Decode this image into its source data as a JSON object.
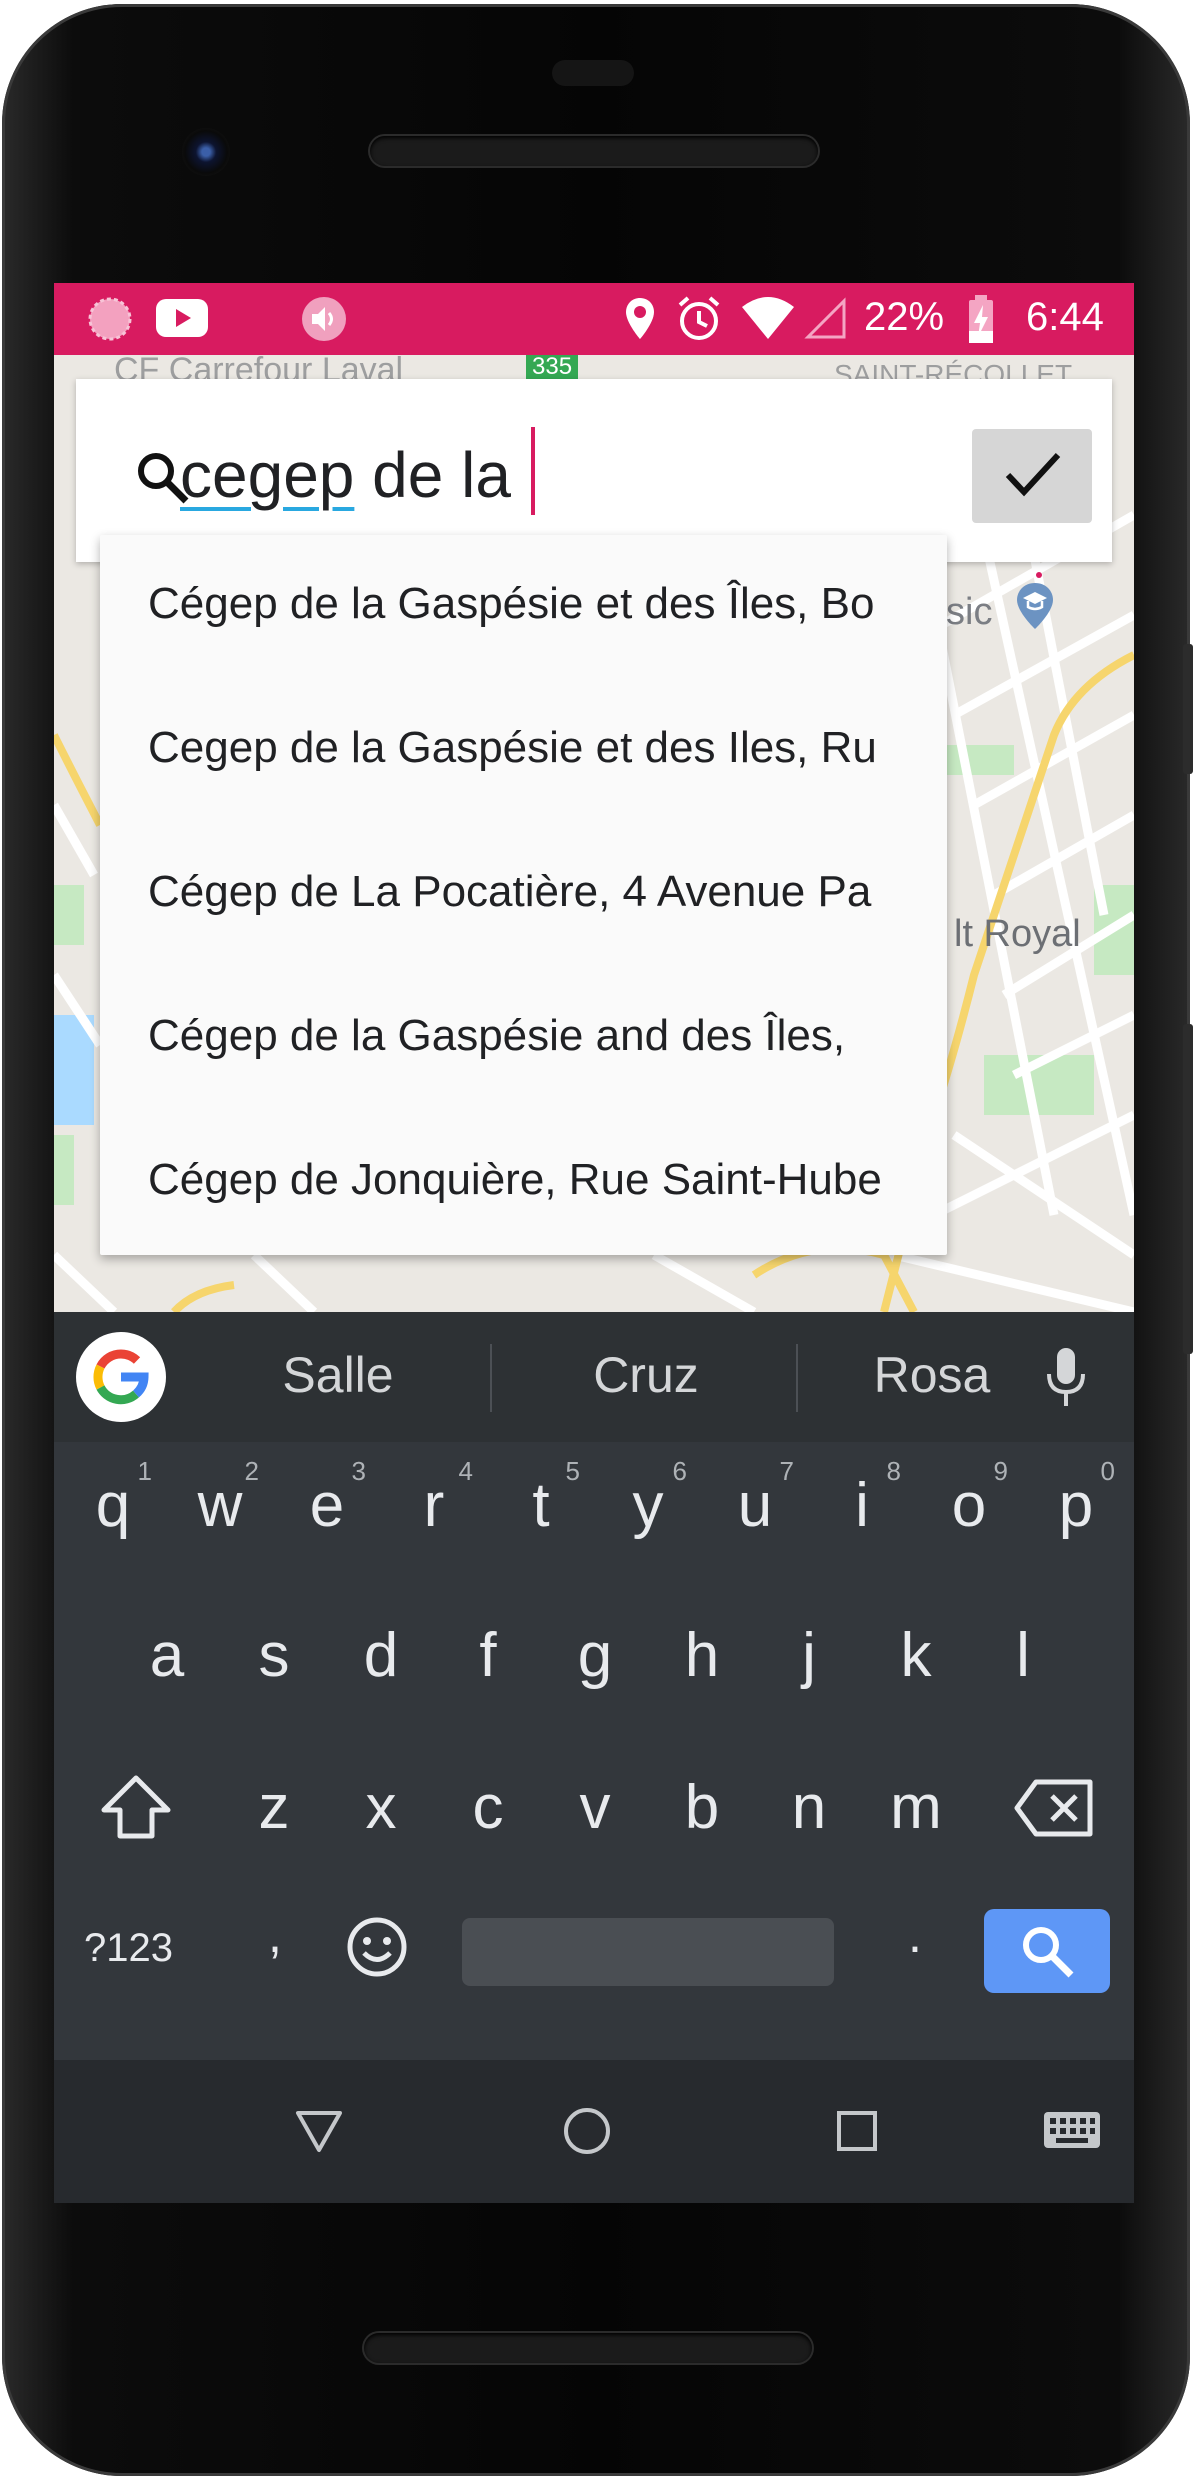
{
  "status_bar": {
    "battery": "22%",
    "time": "6:44",
    "icons": [
      "app-circle-icon",
      "youtube-icon",
      "volume-icon",
      "location-icon",
      "alarm-icon",
      "wifi-icon",
      "signal-icon",
      "battery-charging-icon"
    ],
    "background": "#d81b60"
  },
  "map": {
    "labels": {
      "top_left": "CF Carrefour Laval",
      "road_sign": "335",
      "top_right": "SAINT-RÉCOLLET",
      "middle_right": "sic",
      "lower_right": "lt Royal"
    }
  },
  "search": {
    "query_underlined": "cegep",
    "query_rest": " de la",
    "confirm_icon": "check-icon"
  },
  "suggestions": [
    "Cégep de la Gaspésie et des Îles, Bo",
    "Cegep de la Gaspésie et des Iles, Ru",
    "Cégep de La Pocatière, 4 Avenue Pa",
    "Cégep de la Gaspésie and des Îles,",
    "Cégep de Jonquière, Rue Saint-Hube"
  ],
  "keyboard": {
    "suggestions": [
      "Salle",
      "Cruz",
      "Rosa"
    ],
    "row1": [
      {
        "k": "q",
        "h": "1"
      },
      {
        "k": "w",
        "h": "2"
      },
      {
        "k": "e",
        "h": "3"
      },
      {
        "k": "r",
        "h": "4"
      },
      {
        "k": "t",
        "h": "5"
      },
      {
        "k": "y",
        "h": "6"
      },
      {
        "k": "u",
        "h": "7"
      },
      {
        "k": "i",
        "h": "8"
      },
      {
        "k": "o",
        "h": "9"
      },
      {
        "k": "p",
        "h": "0"
      }
    ],
    "row2": [
      "a",
      "s",
      "d",
      "f",
      "g",
      "h",
      "j",
      "k",
      "l"
    ],
    "row3": [
      "z",
      "x",
      "c",
      "v",
      "b",
      "n",
      "m"
    ],
    "symbols_key": "?123",
    "comma_key": ",",
    "period_key": ".",
    "accent": "#5e97f6"
  },
  "nav_bar": {
    "icons": [
      "back-icon",
      "home-icon",
      "recents-icon",
      "keyboard-switch-icon"
    ]
  }
}
